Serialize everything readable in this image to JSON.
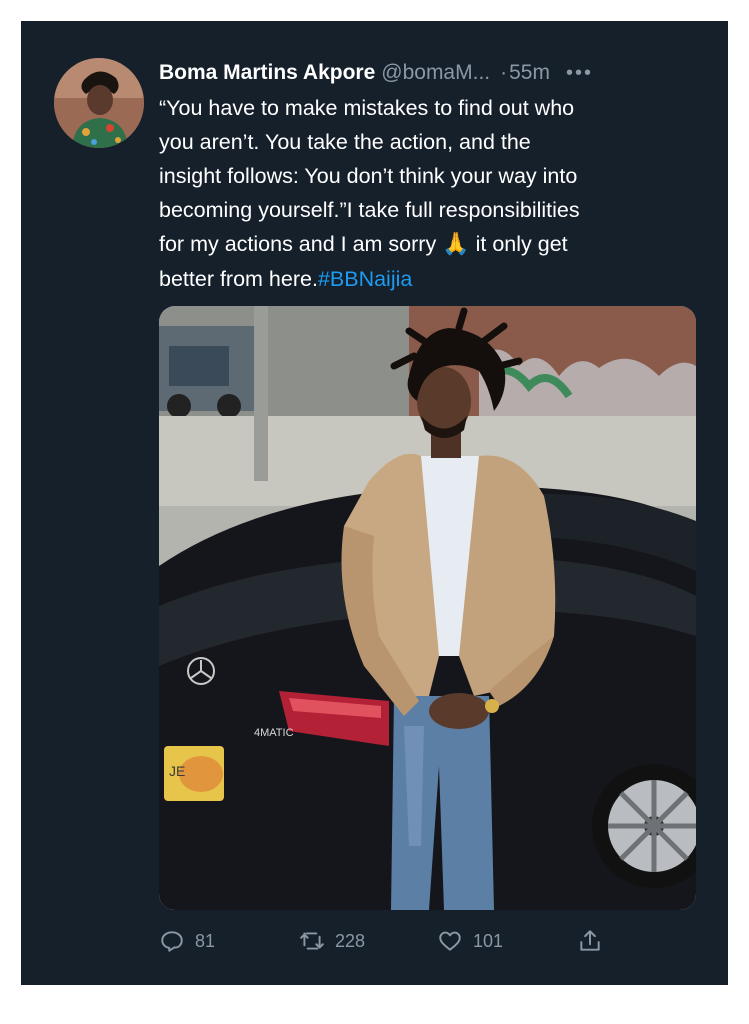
{
  "tweet": {
    "author_name": "Boma Martins Akpore",
    "handle": "@bomaM...",
    "separator": "·",
    "time": "55m",
    "more_label": "•••",
    "lines": [
      "“You have to make mistakes to find out who",
      "you aren’t. You take the action, and the",
      "insight follows: You don’t think your way into",
      "becoming yourself.”I take full responsibilities"
    ],
    "line5_before": "for my actions and I am sorry",
    "emoji": "🙏",
    "line5_after": "it only get",
    "line6_text": "better from here.",
    "hashtag": "#BBNaijia",
    "plate_text": "JE",
    "car_badge": "4MATIC"
  },
  "actions": {
    "replies": "81",
    "retweets": "228",
    "likes": "101"
  },
  "colors": {
    "background": "#15202b",
    "text": "#ffffff",
    "muted": "#8b98a5",
    "link": "#1d9bf0"
  },
  "icons": {
    "reply": "reply-icon",
    "retweet": "retweet-icon",
    "like": "heart-icon",
    "share": "share-icon",
    "more": "more-icon"
  }
}
